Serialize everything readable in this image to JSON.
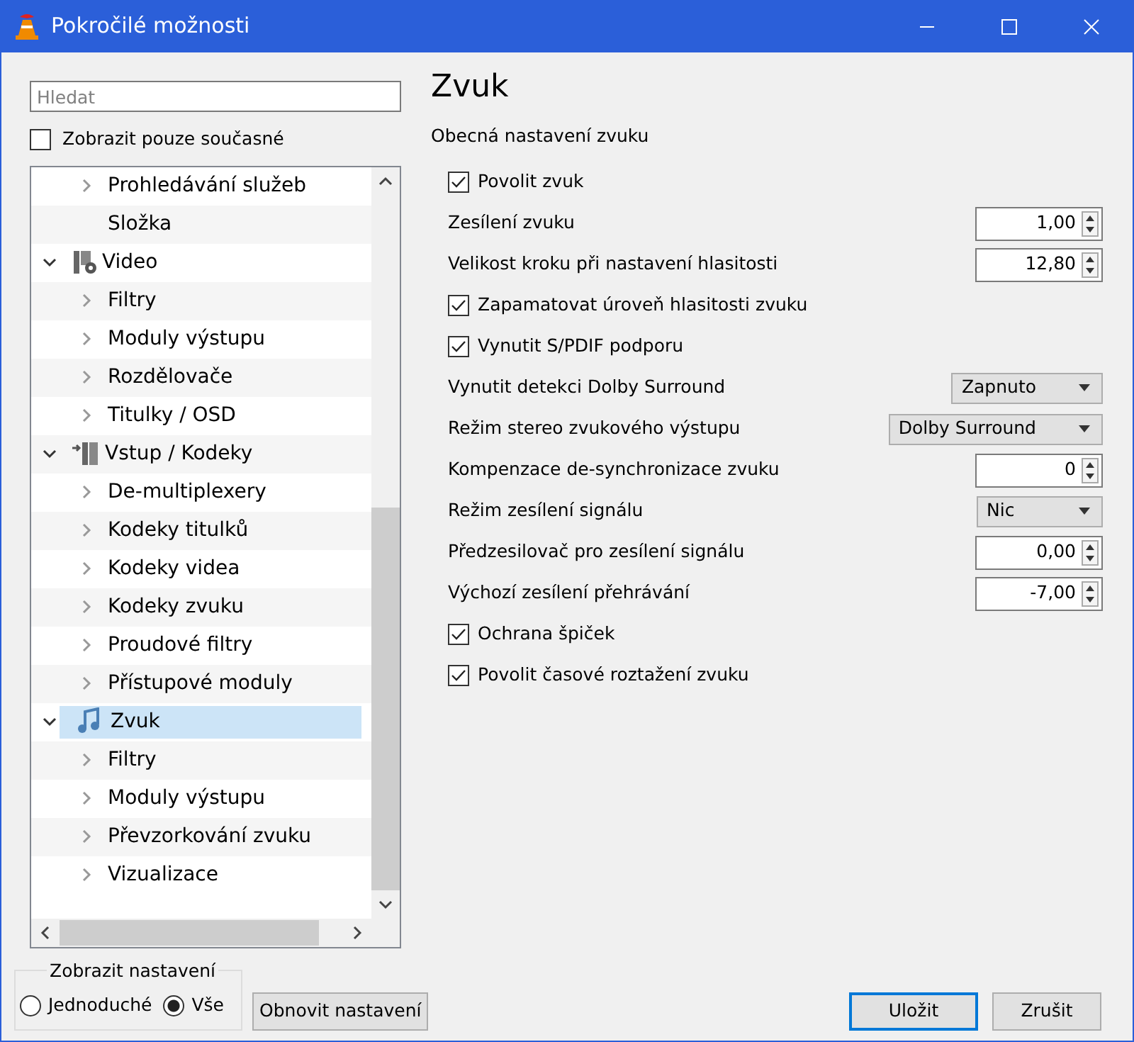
{
  "window": {
    "title": "Pokročilé možnosti"
  },
  "search": {
    "placeholder": "Hledat"
  },
  "show_current_only": {
    "label": "Zobrazit pouze současné",
    "checked": false
  },
  "tree": [
    {
      "children": [
        {
          "label": "Prohledávání služeb",
          "expanded": false,
          "selected": false
        },
        {
          "label": "Složka",
          "selected": false
        }
      ]
    },
    {
      "label": "Video",
      "expanded": true,
      "selected": false,
      "children": [
        {
          "label": "Filtry",
          "expanded": false,
          "selected": false
        },
        {
          "label": "Moduly výstupu",
          "expanded": false,
          "selected": false
        },
        {
          "label": "Rozdělovače",
          "expanded": false,
          "selected": false
        },
        {
          "label": "Titulky / OSD",
          "expanded": false,
          "selected": false
        }
      ]
    },
    {
      "label": "Vstup / Kodeky",
      "expanded": true,
      "selected": false,
      "children": [
        {
          "label": "De-multiplexery",
          "expanded": false,
          "selected": false
        },
        {
          "label": "Kodeky titulků",
          "expanded": false,
          "selected": false
        },
        {
          "label": "Kodeky videa",
          "expanded": false,
          "selected": false
        },
        {
          "label": "Kodeky zvuku",
          "expanded": false,
          "selected": false
        },
        {
          "label": "Proudové filtry",
          "expanded": false,
          "selected": false
        },
        {
          "label": "Přístupové moduly",
          "expanded": false,
          "selected": false
        }
      ]
    },
    {
      "label": "Zvuk",
      "expanded": true,
      "selected": true,
      "children": [
        {
          "label": "Filtry",
          "expanded": false,
          "selected": false
        },
        {
          "label": "Moduly výstupu",
          "expanded": false,
          "selected": false
        },
        {
          "label": "Převzorkování zvuku",
          "expanded": false,
          "selected": false
        },
        {
          "label": "Vizualizace",
          "expanded": false,
          "selected": false
        }
      ]
    }
  ],
  "panel": {
    "title": "Zvuk",
    "section": "Obecná nastavení zvuku",
    "settings": [
      {
        "kind": "checkbox",
        "label": "Povolit zvuk",
        "checked": true
      },
      {
        "kind": "spin",
        "label": "Zesílení zvuku",
        "value": "1,00"
      },
      {
        "kind": "spin",
        "label": "Velikost kroku při nastavení hlasitosti",
        "value": "12,80"
      },
      {
        "kind": "checkbox",
        "label": "Zapamatovat úroveň hlasitosti zvuku",
        "checked": true
      },
      {
        "kind": "checkbox",
        "label": "Vynutit S/PDIF podporu",
        "checked": true
      },
      {
        "kind": "select",
        "label": "Vynutit detekci Dolby Surround",
        "value": "Zapnuto"
      },
      {
        "kind": "select",
        "label": "Režim stereo zvukového výstupu",
        "value": "Dolby Surround"
      },
      {
        "kind": "spin",
        "label": "Kompenzace de-synchronizace zvuku",
        "value": "0"
      },
      {
        "kind": "select",
        "label": "Režim zesílení signálu",
        "value": "Nic"
      },
      {
        "kind": "spin",
        "label": "Předzesilovač pro zesílení signálu",
        "value": "0,00"
      },
      {
        "kind": "spin",
        "label": "Výchozí zesílení přehrávání",
        "value": "-7,00"
      },
      {
        "kind": "checkbox",
        "label": "Ochrana špiček",
        "checked": true
      },
      {
        "kind": "checkbox",
        "label": "Povolit časové roztažení zvuku",
        "checked": true
      }
    ]
  },
  "show_settings": {
    "label": "Zobrazit nastavení",
    "options": [
      {
        "label": "Jednoduché",
        "selected": false
      },
      {
        "label": "Vše",
        "selected": true
      }
    ]
  },
  "buttons": [
    {
      "label": "Obnovit nastavení",
      "kind": "reset"
    },
    {
      "label": "Uložit",
      "kind": "default"
    },
    {
      "label": "Zrušit",
      "kind": "normal"
    }
  ]
}
